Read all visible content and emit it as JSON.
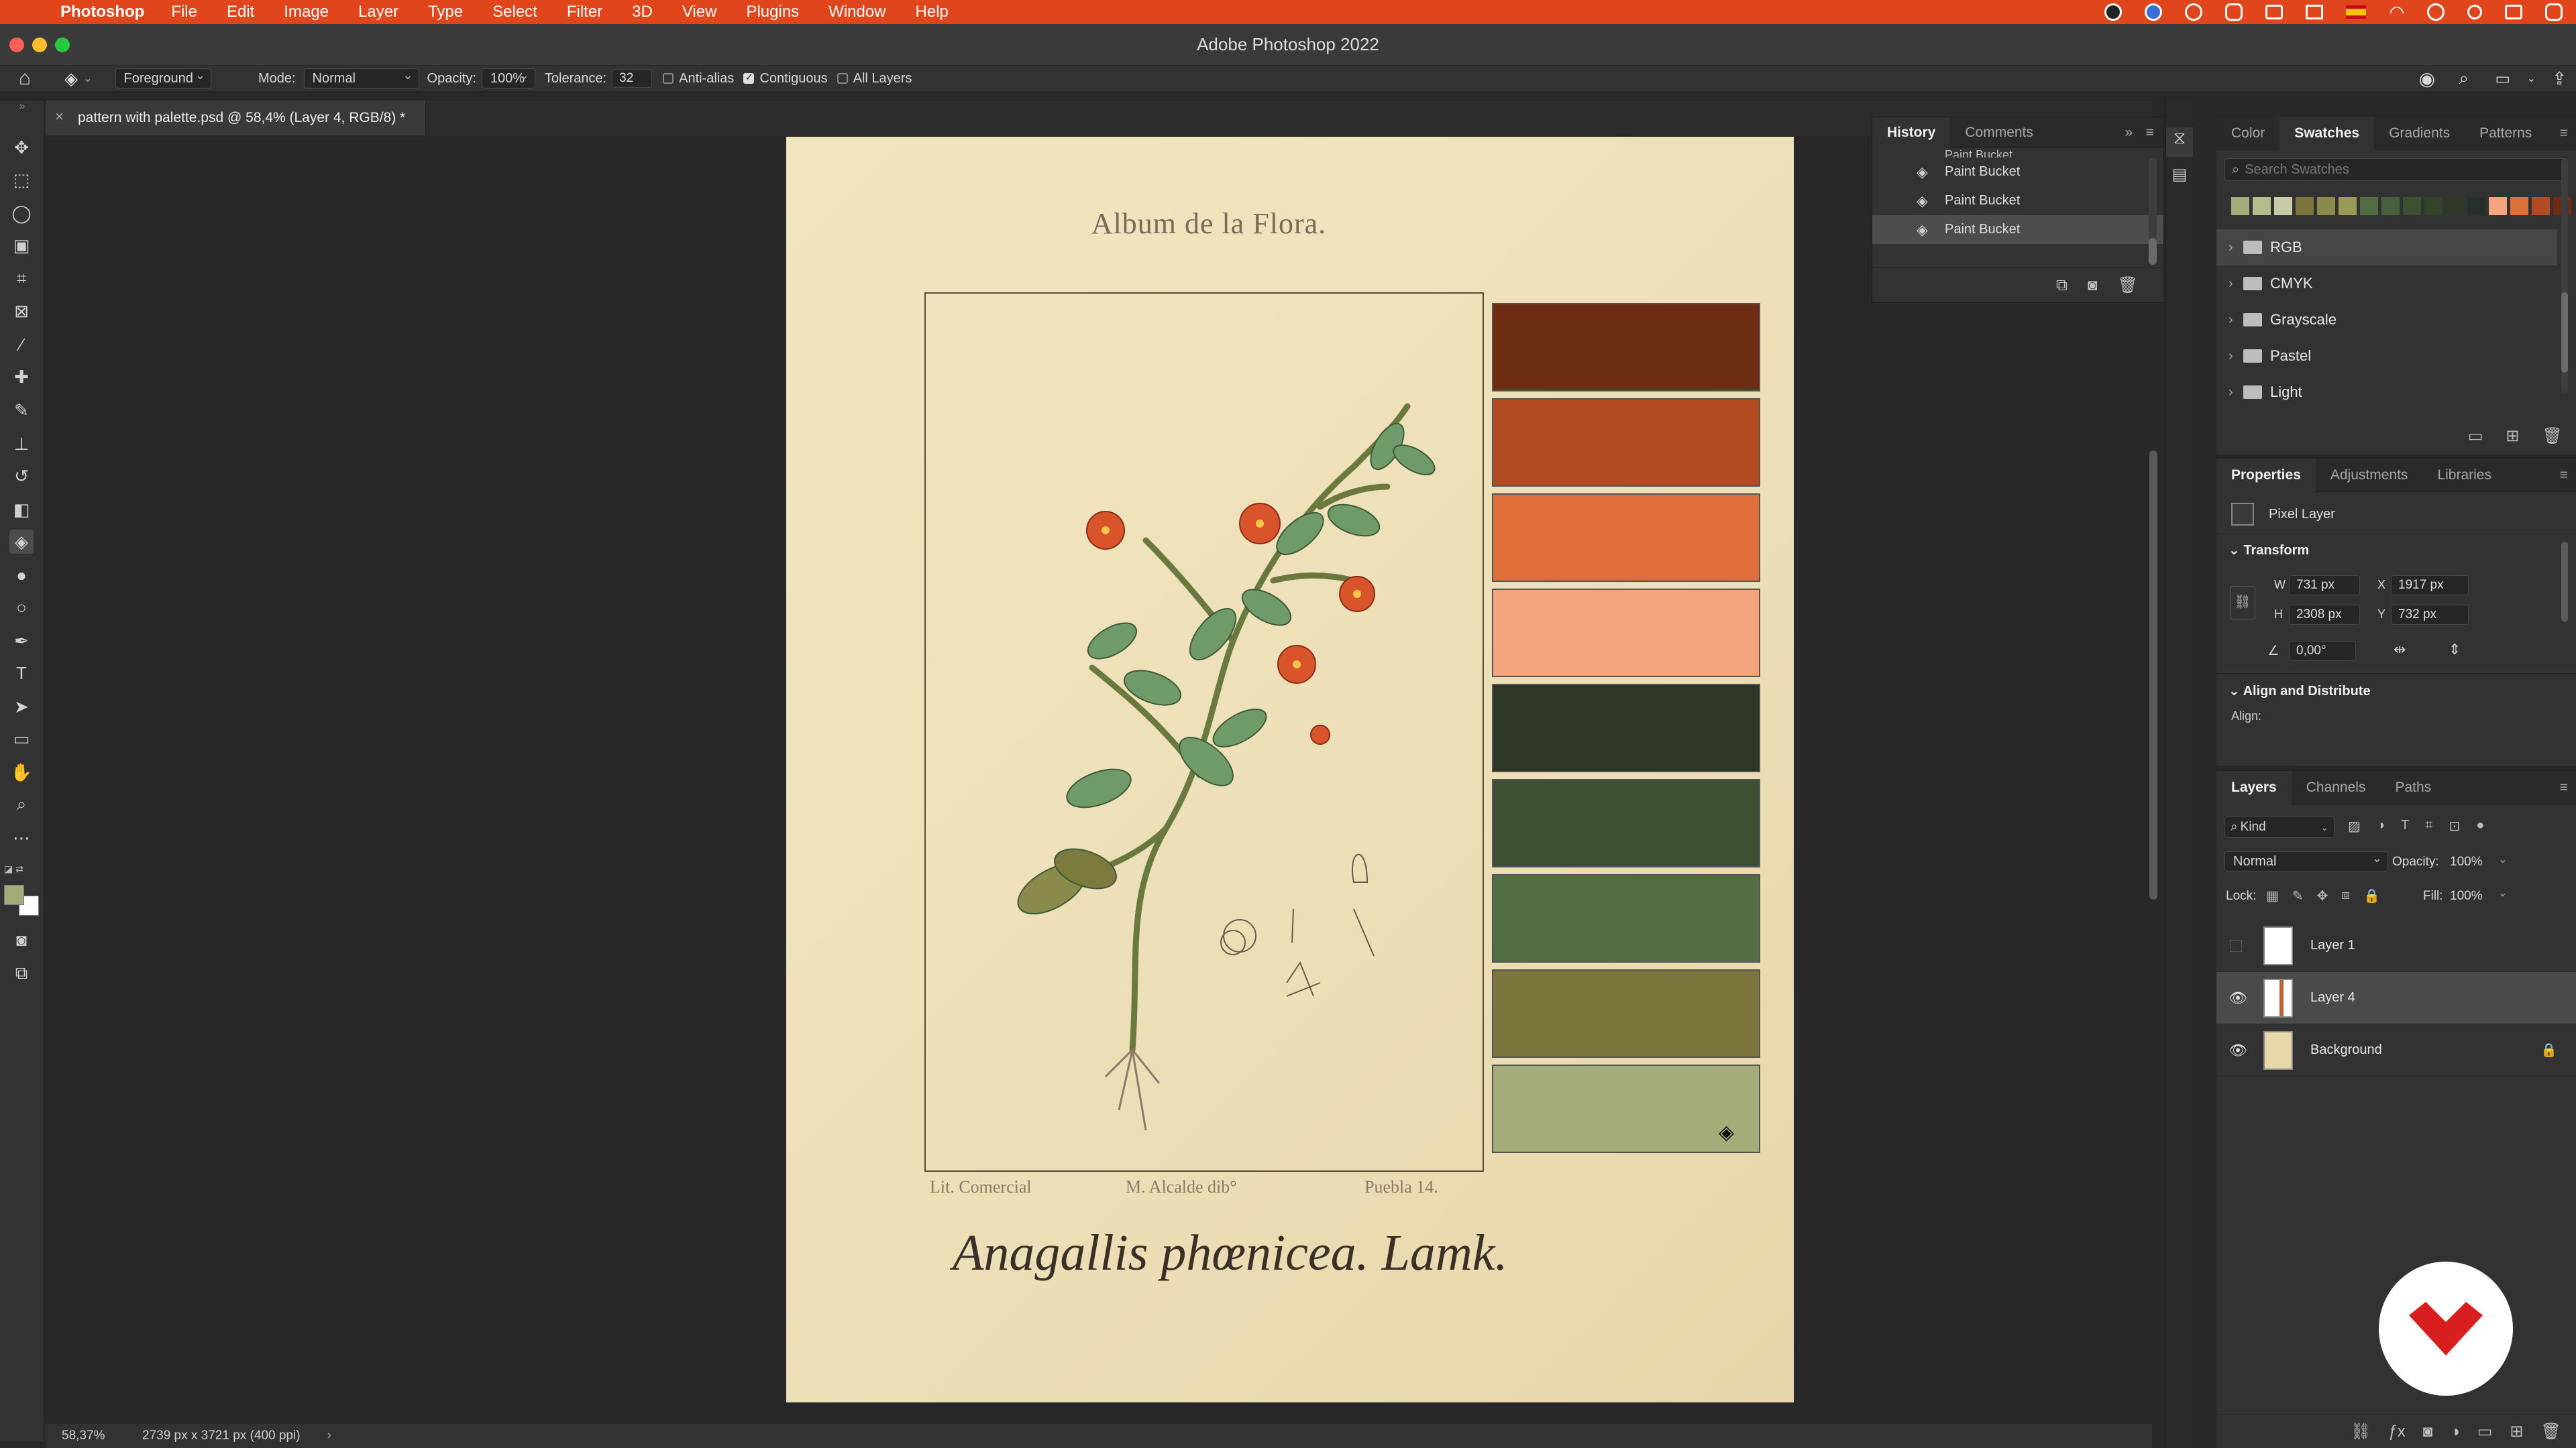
{
  "menubar": {
    "app": "Photoshop",
    "items": [
      "File",
      "Edit",
      "Image",
      "Layer",
      "Type",
      "Select",
      "Filter",
      "3D",
      "View",
      "Plugins",
      "Window",
      "Help"
    ]
  },
  "window": {
    "title": "Adobe Photoshop 2022"
  },
  "options": {
    "fill_source": "Foreground",
    "mode_label": "Mode:",
    "mode_value": "Normal",
    "opacity_label": "Opacity:",
    "opacity_value": "100%",
    "tolerance_label": "Tolerance:",
    "tolerance_value": "32",
    "anti_alias_label": "Anti-alias",
    "anti_alias_checked": false,
    "contiguous_label": "Contiguous",
    "contiguous_checked": true,
    "all_layers_label": "All Layers",
    "all_layers_checked": false
  },
  "document": {
    "tab_title": "pattern with palette.psd @ 58,4% (Layer 4, RGB/8) *",
    "close_glyph": "×"
  },
  "artwork": {
    "header": "Album de la Flora.",
    "credit_left": "Lit. Comercial",
    "credit_center": "M. Alcalde dib°",
    "credit_right": "Puebla 14.",
    "species": "Anagallis phœnicea. Lamk.",
    "swatch_colors": [
      "#6e2d12",
      "#b24a22",
      "#e0703a",
      "#f4a57e",
      "#2e3626",
      "#3e5032",
      "#526c44",
      "#7c763c",
      "#a4ac7a"
    ]
  },
  "status": {
    "zoom": "58,37%",
    "doc_info": "2739 px x 3721 px (400 ppi)",
    "arrow": "›"
  },
  "history": {
    "tabs": [
      "History",
      "Comments"
    ],
    "active_tab": "History",
    "items": [
      "Paint Bucket",
      "Paint Bucket",
      "Paint Bucket",
      "Paint Bucket"
    ]
  },
  "swatches_panel": {
    "tabs": [
      "Color",
      "Swatches",
      "Gradients",
      "Patterns"
    ],
    "active_tab": "Swatches",
    "search_placeholder": "Search Swatches",
    "recent_colors": [
      "#a4ac7a",
      "#b6bb8c",
      "#c8caa8",
      "#7c763c",
      "#8a8a4a",
      "#9a9a56",
      "#526c44",
      "#48603c",
      "#3e5032",
      "#344428",
      "#2e3626",
      "#26302a",
      "#f4a57e",
      "#e0703a",
      "#b24a22",
      "#6e2d12"
    ],
    "groups": [
      "RGB",
      "CMYK",
      "Grayscale",
      "Pastel",
      "Light"
    ]
  },
  "properties": {
    "tabs": [
      "Properties",
      "Adjustments",
      "Libraries"
    ],
    "active_tab": "Properties",
    "layer_type": "Pixel Layer",
    "transform_title": "Transform",
    "w_label": "W",
    "w_value": "731 px",
    "h_label": "H",
    "h_value": "2308 px",
    "x_label": "X",
    "x_value": "1917 px",
    "y_label": "Y",
    "y_value": "732 px",
    "angle_value": "0,00°",
    "align_title": "Align and Distribute",
    "align_label": "Align:"
  },
  "layers": {
    "tabs": [
      "Layers",
      "Channels",
      "Paths"
    ],
    "active_tab": "Layers",
    "filter_label": "Kind",
    "blend_mode": "Normal",
    "opacity_label": "Opacity:",
    "opacity_value": "100%",
    "lock_label": "Lock:",
    "fill_label": "Fill:",
    "fill_value": "100%",
    "items": [
      {
        "name": "Layer 1",
        "visible": false,
        "selected": false
      },
      {
        "name": "Layer 4",
        "visible": true,
        "selected": true
      },
      {
        "name": "Background",
        "visible": true,
        "selected": false,
        "locked": true
      }
    ]
  },
  "colors": {
    "menubar_bg": "#e0451c",
    "foreground": "#a4ac7a",
    "background": "#ffffff",
    "brand_logo": "#d81e1e"
  }
}
